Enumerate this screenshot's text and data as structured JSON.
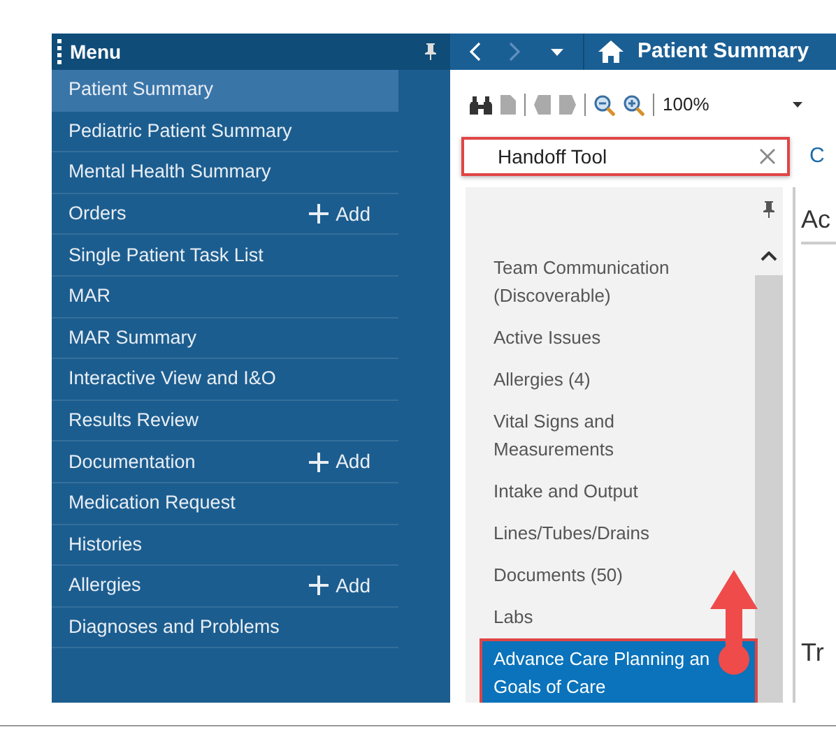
{
  "menu": {
    "title": "Menu",
    "items": [
      {
        "label": "Patient Summary",
        "selected": true
      },
      {
        "label": "Pediatric Patient Summary",
        "selected": false
      },
      {
        "label": "Mental Health Summary",
        "selected": false
      },
      {
        "label": "Orders",
        "selected": false,
        "action": "Add"
      },
      {
        "label": "Single Patient Task List",
        "selected": false
      },
      {
        "label": "MAR",
        "selected": false
      },
      {
        "label": "MAR Summary",
        "selected": false
      },
      {
        "label": "Interactive View and I&O",
        "selected": false
      },
      {
        "label": "Results Review",
        "selected": false
      },
      {
        "label": "Documentation",
        "selected": false,
        "action": "Add"
      },
      {
        "label": "Medication Request",
        "selected": false
      },
      {
        "label": "Histories",
        "selected": false
      },
      {
        "label": "Allergies",
        "selected": false,
        "action": "Add"
      },
      {
        "label": "Diagnoses and Problems",
        "selected": false
      }
    ]
  },
  "nav": {
    "title": "Patient Summary"
  },
  "toolbar": {
    "zoom": "100%"
  },
  "search": {
    "value": "Handoff Tool"
  },
  "tab_partial": "C",
  "components": {
    "items": [
      {
        "label": "Team Communication (Discoverable)",
        "selected": false
      },
      {
        "label": "Active Issues",
        "selected": false
      },
      {
        "label": "Allergies (4)",
        "selected": false
      },
      {
        "label": "Vital Signs and Measurements",
        "selected": false
      },
      {
        "label": "Intake and Output",
        "selected": false
      },
      {
        "label": "Lines/Tubes/Drains",
        "selected": false
      },
      {
        "label": "Documents (50)",
        "selected": false
      },
      {
        "label": "Labs",
        "selected": false
      },
      {
        "label": "Advance Care Planning an Goals of Care",
        "selected": true
      }
    ]
  },
  "content": {
    "heading_1": "Ac",
    "heading_2": "Tr"
  }
}
